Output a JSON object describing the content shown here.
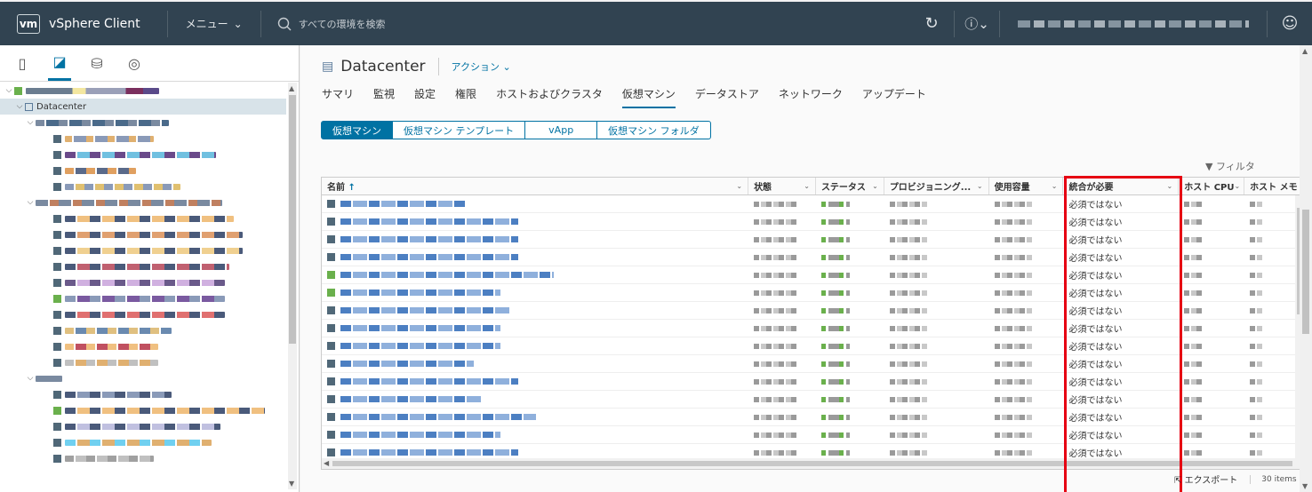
{
  "header": {
    "logo": "vm",
    "app_title": "vSphere Client",
    "menu_label": "メニュー",
    "search_placeholder": "すべての環境を検索"
  },
  "nav": {
    "tree_selected": "Datacenter"
  },
  "main": {
    "title": "Datacenter",
    "actions_label": "アクション",
    "tabs": [
      "サマリ",
      "監視",
      "設定",
      "権限",
      "ホストおよびクラスタ",
      "仮想マシン",
      "データストア",
      "ネットワーク",
      "アップデート"
    ],
    "active_tab": "仮想マシン",
    "subtabs": [
      "仮想マシン",
      "仮想マシン テンプレート",
      "vApp",
      "仮想マシン フォルダ"
    ],
    "filter_label": "フィルタ",
    "columns": [
      "名前",
      "状態",
      "ステータス",
      "プロビジョニング...",
      "使用容量",
      "統合が必要",
      "ホスト CPU",
      "ホスト メモ"
    ],
    "consolidation_values": [
      "必須ではない",
      "必須ではない",
      "必須ではない",
      "必須ではない",
      "必須ではない",
      "必須ではない",
      "必須ではない",
      "必須ではない",
      "必須ではない",
      "必須ではない",
      "必須ではない",
      "必須ではない",
      "必須ではない",
      "必須ではない",
      "必須ではない"
    ],
    "export_label": "エクスポート",
    "item_count": "30 items"
  },
  "colors": {
    "header_bg": "#314351",
    "accent": "#0072a3",
    "highlight": "#e60012"
  }
}
